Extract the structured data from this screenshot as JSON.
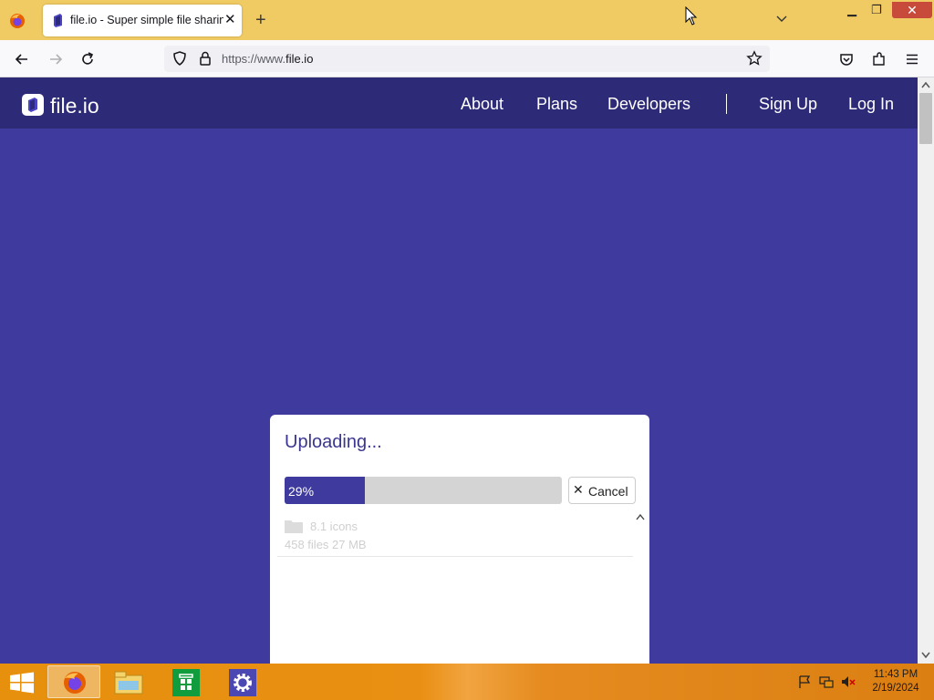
{
  "browser": {
    "tab_title": "file.io - Super simple file sharing",
    "url_prefix": "https://www.",
    "url_domain": "file.io",
    "new_tab_label": "+"
  },
  "site": {
    "logo_text": "file.io",
    "nav": [
      {
        "label": "About"
      },
      {
        "label": "Plans"
      },
      {
        "label": "Developers"
      },
      {
        "label": "Sign Up"
      },
      {
        "label": "Log In"
      }
    ]
  },
  "upload": {
    "heading": "Uploading...",
    "progress_percent": 29,
    "progress_label": "29%",
    "cancel_label": "Cancel",
    "files": [
      {
        "name": "8.1 icons",
        "meta": "458 files 27 MB",
        "icon": "folder-icon"
      }
    ]
  },
  "taskbar": {
    "apps": [
      "firefox-icon",
      "file-explorer-icon",
      "store-icon",
      "settings-icon"
    ],
    "time": "11:43 PM",
    "date": "2/19/2024"
  },
  "colors": {
    "page_bg": "#3f3a9e",
    "header_bg": "#2d2a78",
    "tabstrip_bg": "#f0ca62",
    "taskbar_bg": "#e6900e",
    "accent": "#3f3a9e"
  }
}
